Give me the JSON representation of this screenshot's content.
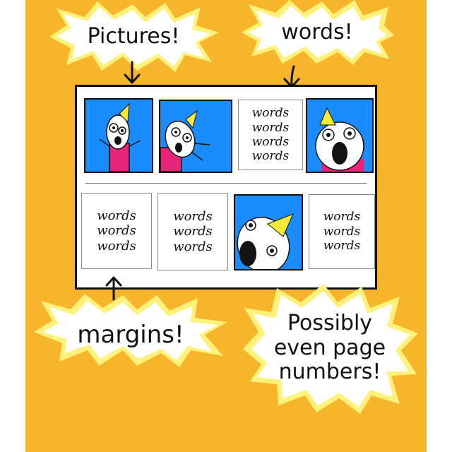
{
  "callouts": {
    "pictures": "Pictures!",
    "words": "words!",
    "margins": "margins!",
    "page_numbers_line1": "Possibly",
    "page_numbers_line2": "even page",
    "page_numbers_line3": "numbers!"
  },
  "page": {
    "row1": {
      "text_block": [
        "words",
        "words",
        "words",
        "words"
      ]
    },
    "row2": {
      "text_block_1": [
        "words",
        "words",
        "words"
      ],
      "text_block_2": [
        "words",
        "words",
        "words"
      ],
      "text_block_3": [
        "words",
        "words",
        "words"
      ]
    }
  },
  "colors": {
    "background": "#f7b52b",
    "burst_fill": "#ffffff",
    "burst_glow": "#fff27a",
    "picture_bg": "#1a8cff",
    "creature_hat": "#f5e93a",
    "creature_shirt": "#e8237a"
  },
  "icons": [
    "down-arrow-icon",
    "up-arrow-icon",
    "creature-illustration"
  ]
}
